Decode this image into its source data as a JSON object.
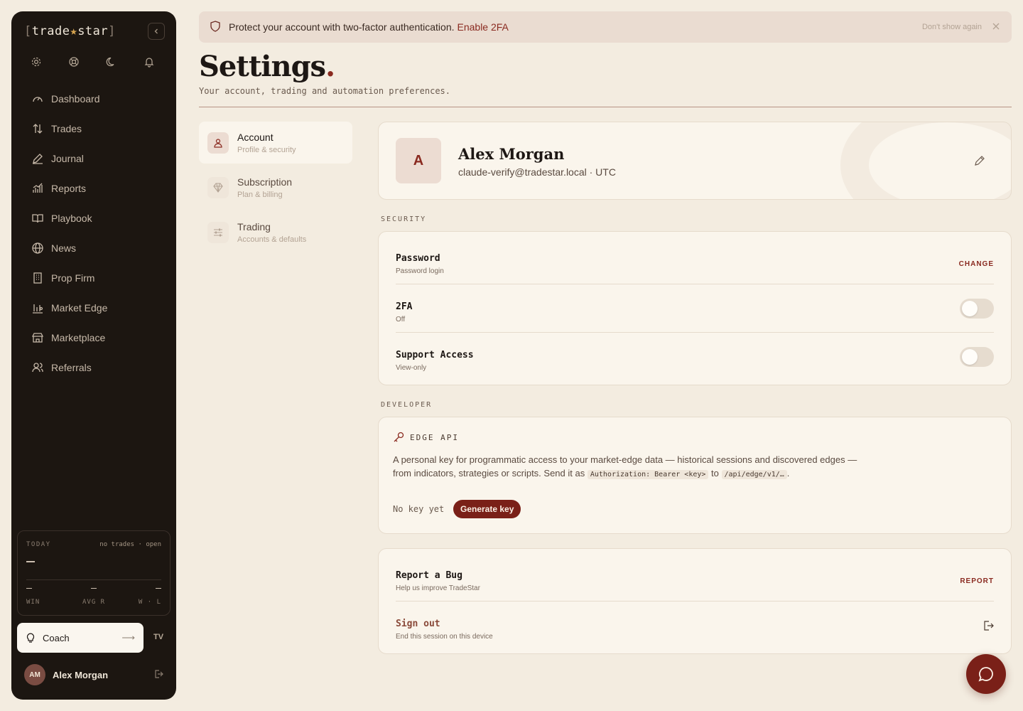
{
  "logo": {
    "open": "[",
    "left": "trade",
    "star": "★",
    "right": "star",
    "close": "]"
  },
  "sidebar": {
    "items": [
      {
        "label": "Dashboard",
        "icon": "gauge-icon"
      },
      {
        "label": "Trades",
        "icon": "arrows-updown-icon"
      },
      {
        "label": "Journal",
        "icon": "pen-icon"
      },
      {
        "label": "Reports",
        "icon": "bar-chart-icon"
      },
      {
        "label": "Playbook",
        "icon": "book-icon"
      },
      {
        "label": "News",
        "icon": "globe-icon"
      },
      {
        "label": "Prop Firm",
        "icon": "building-icon"
      },
      {
        "label": "Market Edge",
        "icon": "chart-bars-icon"
      },
      {
        "label": "Marketplace",
        "icon": "store-icon"
      },
      {
        "label": "Referrals",
        "icon": "users-icon"
      }
    ],
    "today": {
      "label": "TODAY",
      "status": "no trades · open",
      "win": "WIN",
      "avg_r": "AVG R",
      "wl": "W · L"
    },
    "coach": "Coach",
    "tv": "TV",
    "user": {
      "initials": "AM",
      "name": "Alex Morgan"
    }
  },
  "banner": {
    "text": "Protect your account with two-factor authentication.",
    "link": "Enable 2FA",
    "dismiss": "Don't show again"
  },
  "header": {
    "title": "Settings",
    "dot": ".",
    "subtitle": "Your account, trading and automation preferences."
  },
  "settings_nav": [
    {
      "title": "Account",
      "subtitle": "Profile & security"
    },
    {
      "title": "Subscription",
      "subtitle": "Plan & billing"
    },
    {
      "title": "Trading",
      "subtitle": "Accounts & defaults"
    }
  ],
  "profile": {
    "initial": "A",
    "name": "Alex Morgan",
    "email": "claude-verify@tradestar.local · UTC"
  },
  "security": {
    "label": "SECURITY",
    "password": {
      "title": "Password",
      "subtitle": "Password login",
      "action": "CHANGE"
    },
    "twofa": {
      "title": "2FA",
      "subtitle": "Off"
    },
    "support": {
      "title": "Support Access",
      "subtitle": "View-only"
    }
  },
  "developer": {
    "label": "DEVELOPER",
    "title": "EDGE API",
    "desc1": "A personal key for programmatic access to your market-edge data — historical sessions and discovered edges —",
    "desc2": "from indicators, strategies or scripts. Send it as",
    "code1": "Authorization: Bearer <key>",
    "desc3": "to",
    "code2": "/api/edge/v1/…",
    "desc4": ".",
    "nokey": "No key yet",
    "generate": "Generate key"
  },
  "misc": {
    "bug": {
      "title": "Report a Bug",
      "subtitle": "Help us improve TradeStar",
      "action": "REPORT"
    },
    "signout": {
      "title": "Sign out",
      "subtitle": "End this session on this device"
    }
  }
}
